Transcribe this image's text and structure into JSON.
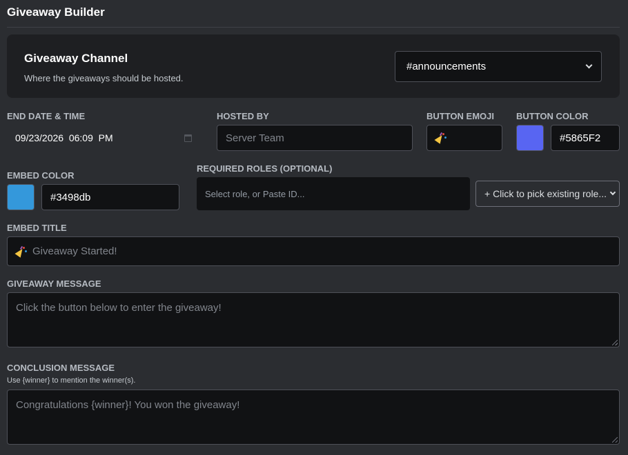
{
  "page": {
    "title": "Giveaway Builder"
  },
  "channel": {
    "title": "Giveaway Channel",
    "description": "Where the giveaways should be hosted.",
    "selected": "#announcements"
  },
  "end_date": {
    "label": "END DATE & TIME",
    "value": "09/23/2026  06:09  PM"
  },
  "hosted_by": {
    "label": "HOSTED BY",
    "placeholder": "Server Team"
  },
  "button_emoji": {
    "label": "BUTTON EMOJI",
    "icon": "party-popper-icon"
  },
  "button_color": {
    "label": "BUTTON COLOR",
    "value": "#5865F2"
  },
  "embed_color": {
    "label": "EMBED COLOR",
    "value": "#3498db"
  },
  "required_roles": {
    "label": "REQUIRED ROLES (OPTIONAL)",
    "placeholder": "Select role, or Paste ID...",
    "picker": "+ Click to pick existing role..."
  },
  "embed_title": {
    "label": "EMBED TITLE",
    "value": "Giveaway Started!",
    "icon": "party-popper-icon"
  },
  "giveaway_message": {
    "label": "GIVEAWAY MESSAGE",
    "placeholder": "Click the button below to enter the giveaway!"
  },
  "conclusion_message": {
    "label": "CONCLUSION MESSAGE",
    "hint": "Use {winner} to mention the winner(s).",
    "placeholder": "Congratulations {winner}! You won the giveaway!"
  },
  "colors": {
    "background": "#2b2d31",
    "card": "#1e1f22",
    "input": "#111214",
    "button_color_swatch": "#5865F2",
    "embed_color_swatch": "#3498db"
  }
}
